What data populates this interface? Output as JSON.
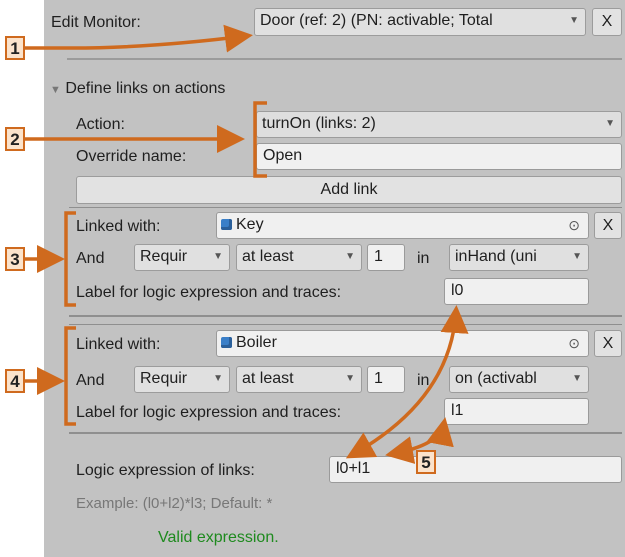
{
  "header": {
    "edit_monitor_label": "Edit Monitor:",
    "monitor_value": "Door (ref: 2) (PN: activable; Total",
    "close": "X"
  },
  "section": {
    "foldout_label": "Define links on actions",
    "action_label": "Action:",
    "action_value": "turnOn (links: 2)",
    "override_label": "Override name:",
    "override_value": "Open",
    "add_link": "Add link"
  },
  "links": [
    {
      "linked_with_label": "Linked with:",
      "object": "Key",
      "and_label": "And",
      "require": "Requir",
      "comparator": "at least",
      "count": "1",
      "in_label": "in",
      "place": "inHand (uni",
      "expr_label": "Label for logic expression and traces:",
      "expr_value": "l0",
      "remove": "X"
    },
    {
      "linked_with_label": "Linked with:",
      "object": "Boiler",
      "and_label": "And",
      "require": "Requir",
      "comparator": "at least",
      "count": "1",
      "in_label": "in",
      "place": "on (activabl",
      "expr_label": "Label for logic expression and traces:",
      "expr_value": "l1",
      "remove": "X"
    }
  ],
  "logic": {
    "label": "Logic expression of links:",
    "value": "l0+l1",
    "example": "Example: (l0+l2)*l3; Default: *",
    "status": "Valid expression."
  },
  "annotations": [
    "1",
    "2",
    "3",
    "4",
    "5"
  ],
  "colors": {
    "panel": "#c2c2c2",
    "annotation": "#cf6a1e",
    "valid": "#1e8a1e"
  },
  "icons": [
    "dropdown-arrow-icon",
    "foldout-triangle-icon",
    "cube-icon",
    "object-picker-icon"
  ]
}
